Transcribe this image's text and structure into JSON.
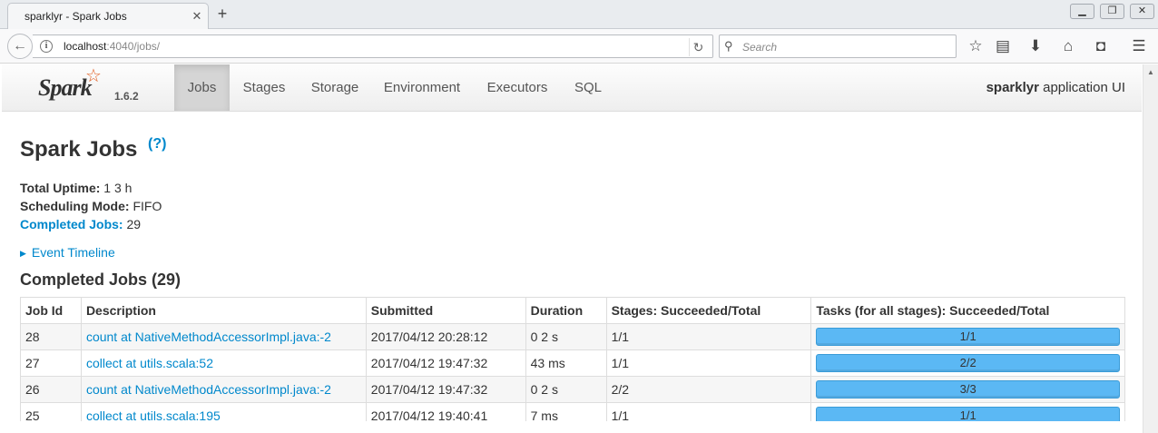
{
  "browser": {
    "tab_title": "sparklyr - Spark Jobs",
    "url_host": "localhost",
    "url_rest": ":4040/jobs/",
    "search_placeholder": "Search"
  },
  "spark": {
    "logo": "Spark",
    "version": "1.6.2",
    "nav": [
      "Jobs",
      "Stages",
      "Storage",
      "Environment",
      "Executors",
      "SQL"
    ],
    "active_nav": "Jobs",
    "app_name_bold": "sparklyr",
    "app_name_rest": " application UI"
  },
  "page": {
    "title": "Spark Jobs",
    "help": "(?)",
    "uptime_label": "Total Uptime:",
    "uptime_value": " 1 3 h",
    "mode_label": "Scheduling Mode:",
    "mode_value": " FIFO",
    "completed_label": "Completed Jobs:",
    "completed_value": " 29",
    "timeline": "Event Timeline",
    "section_title": "Completed Jobs (29)"
  },
  "table": {
    "headers": [
      "Job Id",
      "Description",
      "Submitted",
      "Duration",
      "Stages: Succeeded/Total",
      "Tasks (for all stages): Succeeded/Total"
    ],
    "rows": [
      {
        "id": "28",
        "desc": "count at NativeMethodAccessorImpl.java:-2",
        "submitted": "2017/04/12 20:28:12",
        "duration": "0 2 s",
        "stages": "1/1",
        "tasks": "1/1",
        "progress": 1.0
      },
      {
        "id": "27",
        "desc": "collect at utils.scala:52",
        "submitted": "2017/04/12 19:47:32",
        "duration": "43 ms",
        "stages": "1/1",
        "tasks": "2/2",
        "progress": 1.0
      },
      {
        "id": "26",
        "desc": "count at NativeMethodAccessorImpl.java:-2",
        "submitted": "2017/04/12 19:47:32",
        "duration": "0 2 s",
        "stages": "2/2",
        "tasks": "3/3",
        "progress": 1.0
      },
      {
        "id": "25",
        "desc": "collect at utils.scala:195",
        "submitted": "2017/04/12 19:40:41",
        "duration": "7 ms",
        "stages": "1/1",
        "tasks": "1/1",
        "progress": 1.0
      }
    ]
  },
  "colors": {
    "link": "#0088cc",
    "progress": "#5bb8f4",
    "spark_orange": "#e25a1c"
  }
}
